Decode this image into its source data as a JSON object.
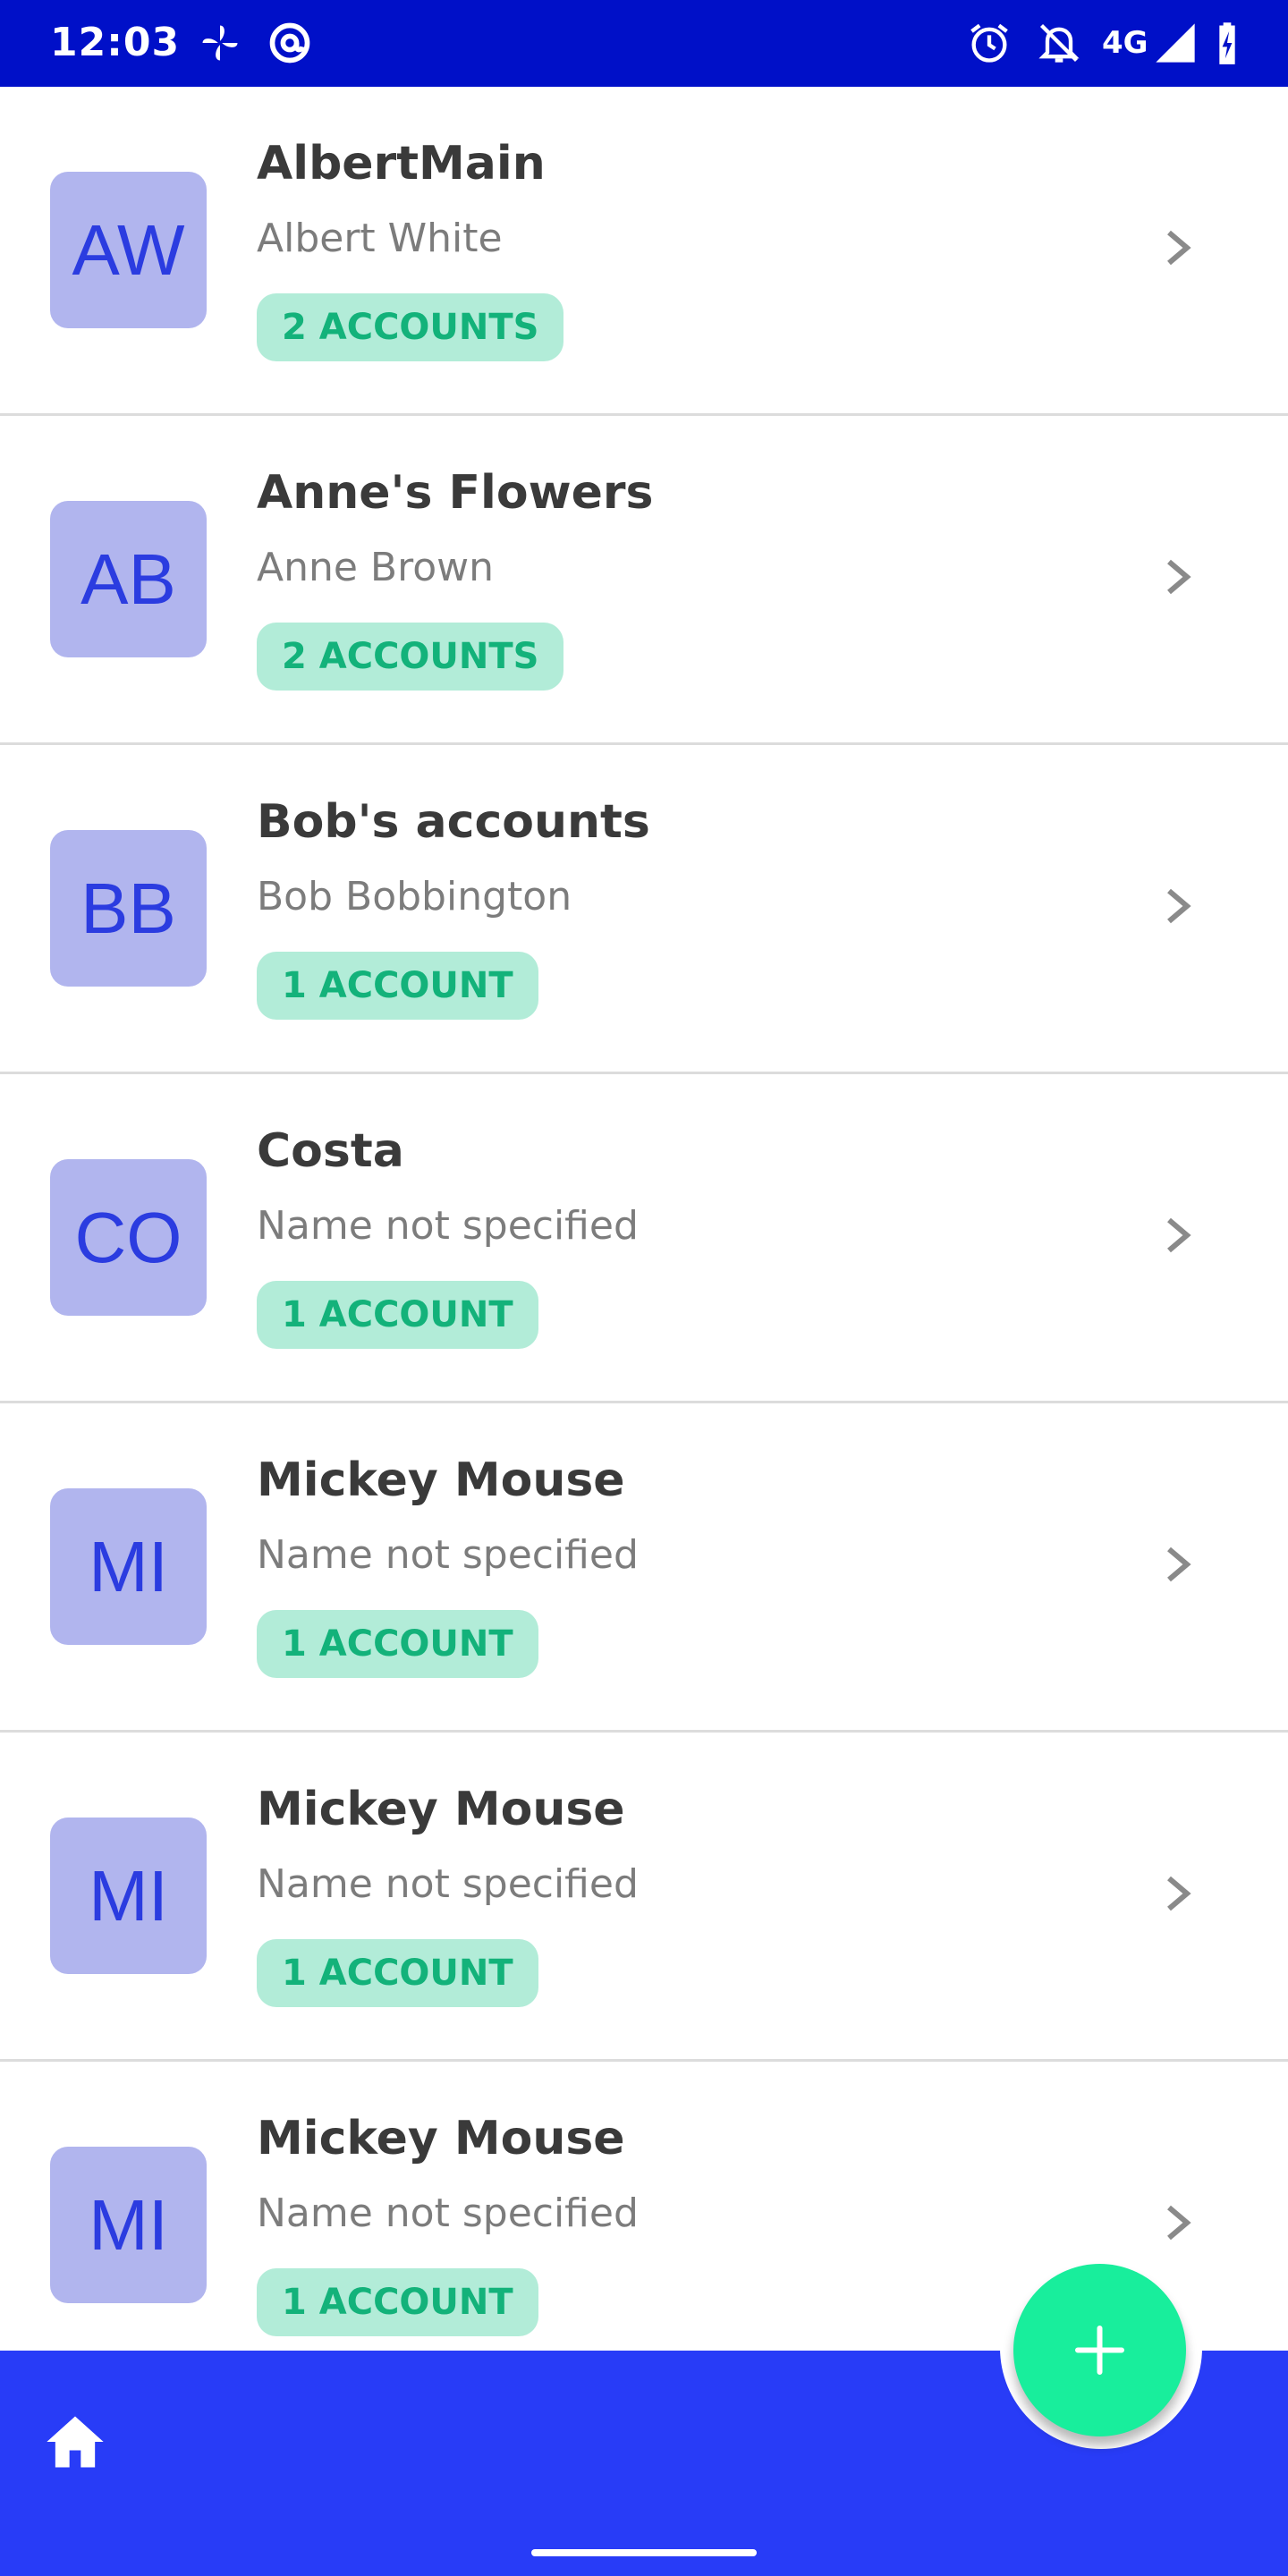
{
  "status_bar": {
    "time": "12:03",
    "network": "4G",
    "icons": [
      "fan-icon",
      "at-sign-icon",
      "alarm-icon",
      "notifications-off-icon",
      "signal-icon",
      "battery-charging-icon"
    ]
  },
  "accounts": [
    {
      "initials": "AW",
      "title": "AlbertMain",
      "subtitle": "Albert White",
      "badge": "2 ACCOUNTS"
    },
    {
      "initials": "AB",
      "title": "Anne's Flowers",
      "subtitle": "Anne Brown",
      "badge": "2 ACCOUNTS"
    },
    {
      "initials": "BB",
      "title": "Bob's accounts",
      "subtitle": "Bob Bobbington",
      "badge": "1 ACCOUNT"
    },
    {
      "initials": "CO",
      "title": "Costa",
      "subtitle": "Name not specified",
      "badge": "1 ACCOUNT"
    },
    {
      "initials": "MI",
      "title": "Mickey Mouse",
      "subtitle": "Name not specified",
      "badge": "1 ACCOUNT"
    },
    {
      "initials": "MI",
      "title": "Mickey Mouse",
      "subtitle": "Name not specified",
      "badge": "1 ACCOUNT"
    },
    {
      "initials": "MI",
      "title": "Mickey Mouse",
      "subtitle": "Name not specified",
      "badge": "1 ACCOUNT"
    }
  ],
  "bottom_nav": {
    "icons": [
      "home-icon"
    ],
    "fab_icon": "plus-icon"
  },
  "colors": {
    "status_bar": "#0010c8",
    "bottom_bar": "#283cf7",
    "fab": "#18ee9c",
    "avatar_bg": "#b1b5ee",
    "avatar_text": "#2b3ce0",
    "badge_bg": "#b2ecd8",
    "badge_text": "#13b27a"
  }
}
